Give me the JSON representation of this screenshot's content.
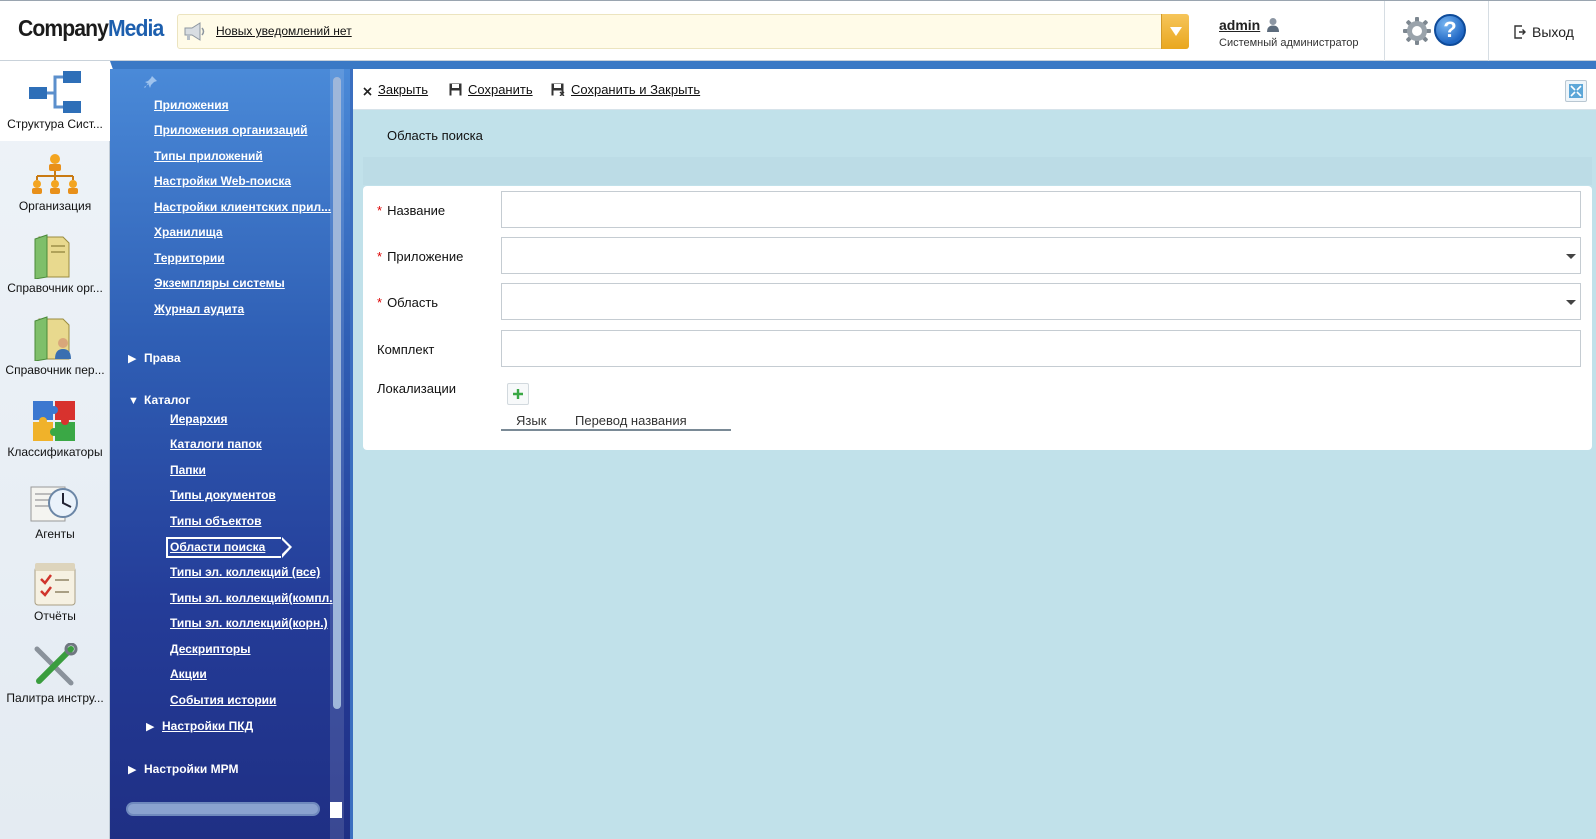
{
  "header": {
    "logo": "CompanyMedia",
    "logo_company": "Company",
    "logo_media": "Media",
    "notifications": "Новых уведомлений нет",
    "user_name": "admin",
    "user_role": "Системный администратор",
    "help_label": "?",
    "logout": "Выход",
    "accent_color": "#3a79c5"
  },
  "modules": [
    {
      "label": "Структура Сист...",
      "icon": "system-structure-icon",
      "active": true
    },
    {
      "label": "Организация",
      "icon": "org-chart-icon"
    },
    {
      "label": "Справочник орг...",
      "icon": "org-directory-icon"
    },
    {
      "label": "Справочник пер...",
      "icon": "personnel-directory-icon"
    },
    {
      "label": "Классификаторы",
      "icon": "puzzle-icon"
    },
    {
      "label": "Агенты",
      "icon": "clock-agent-icon"
    },
    {
      "label": "Отчёты",
      "icon": "report-checklist-icon"
    },
    {
      "label": "Палитра инстру...",
      "icon": "tools-icon"
    }
  ],
  "nav": {
    "top_links": [
      "Приложения",
      "Приложения организаций",
      "Типы приложений",
      "Настройки Web-поиска",
      "Настройки клиентских прил...",
      "Хранилища",
      "Территории",
      "Экземпляры системы",
      "Журнал аудита"
    ],
    "group_rights": "Права",
    "group_catalog": "Каталог",
    "catalog_links": [
      "Иерархия",
      "Каталоги папок",
      "Папки",
      "Типы документов",
      "Типы объектов",
      "Области поиска",
      "Типы эл. коллекций (все)",
      "Типы эл. коллекций(компл.",
      "Типы эл. коллекций(корн.)",
      "Дескрипторы",
      "Акции",
      "События истории"
    ],
    "subgroup_pkd": "Настройки ПКД",
    "group_mrm": "Настройки МРМ",
    "active_item": "Области поиска"
  },
  "toolbar": {
    "close": "Закрыть",
    "save": "Сохранить",
    "save_close": "Сохранить и Закрыть"
  },
  "page": {
    "title": "Область поиска"
  },
  "form": {
    "name_label": "Название",
    "name_value": "",
    "app_label": "Приложение",
    "app_value": "",
    "area_label": "Область",
    "area_value": "",
    "kit_label": "Комплект",
    "kit_value": "",
    "loc_label": "Локализации",
    "loc_col_lang": "Язык",
    "loc_col_translation": "Перевод названия"
  }
}
